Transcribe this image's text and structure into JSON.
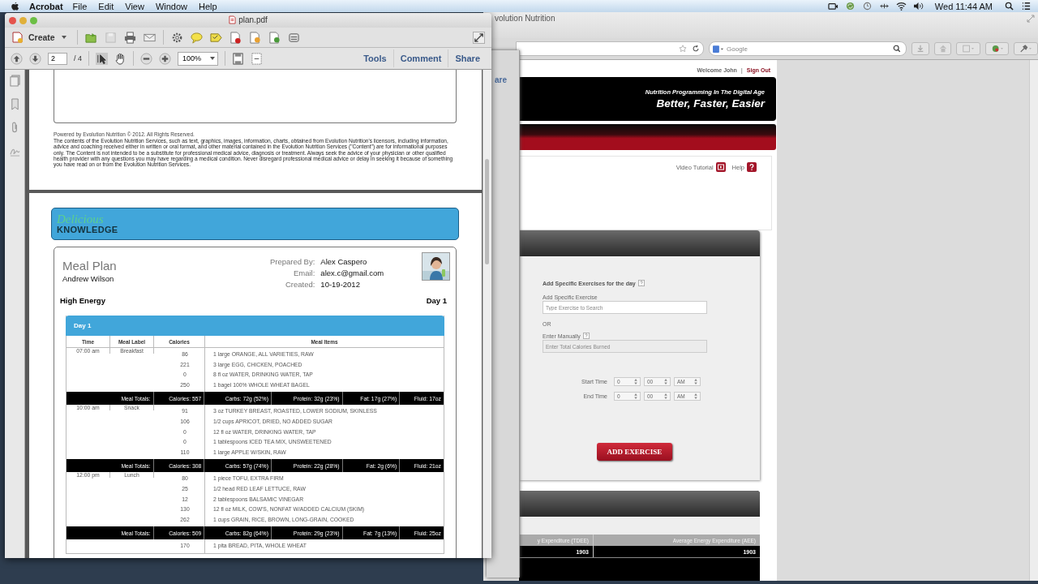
{
  "menubar": {
    "app": "Acrobat",
    "items": [
      "File",
      "Edit",
      "View",
      "Window",
      "Help"
    ],
    "clock": "Wed 11:44 AM"
  },
  "acrobat": {
    "title": "plan.pdf",
    "create": "Create",
    "page": "2",
    "page_count": "/ 4",
    "zoom": "100%",
    "panes": [
      "Tools",
      "Comment",
      "Share"
    ]
  },
  "pdf": {
    "powered": "Powered by Evolution Nutrition © 2012. All Rights Reserved.",
    "disclaimer": "The contents of the Evolution Nutrition Services, such as text, graphics, images, information, charts, obtained from Evolution Nutrition's licensors, including information, advice and coaching received either in written or oral format, and other material contained in the Evolution Nutrition Services (\"Content\") are for informational purposes only. The Content is not intended to be a substitute for professional medical advice, diagnosis or treatment. Always seek the advice of your physician or other qualified health provider with any questions you may have regarding a medical condition. Never disregard professional medical advice or delay in seeking it because of something you have read on or from the Evolution Nutrition Services.",
    "logo_script": "Delicious",
    "logo_word": "KNOWLEDGE",
    "heading": "Meal Plan",
    "client": "Andrew Wilson",
    "details": [
      {
        "label": "Prepared By:",
        "value": "Alex Caspero"
      },
      {
        "label": "Email:",
        "value": "alex.c@gmail.com"
      },
      {
        "label": "Created:",
        "value": "10-19-2012"
      }
    ],
    "plan_name": "High Energy",
    "day_label": "Day 1",
    "table": {
      "title": "Day 1",
      "columns": [
        "Time",
        "Meal Label",
        "Calories",
        "Meal Items"
      ],
      "meals": [
        {
          "time": "07:00 am",
          "label": "Breakfast",
          "items": [
            {
              "calories": "86",
              "item": "1 large ORANGE, ALL VARIETIES, RAW"
            },
            {
              "calories": "221",
              "item": "3 large EGG, CHICKEN, POACHED"
            },
            {
              "calories": "0",
              "item": "8 fl oz WATER, DRINKING WATER, TAP"
            },
            {
              "calories": "250",
              "item": "1 bagel 100% WHOLE WHEAT BAGEL"
            }
          ],
          "totals": {
            "label": "Meal Totals:",
            "values": [
              "Calories: 557",
              "Carbs: 72g (52%)",
              "Protein: 32g (23%)",
              "Fat: 17g (27%)",
              "Fluid: 17oz"
            ]
          }
        },
        {
          "time": "10:00 am",
          "label": "Snack",
          "items": [
            {
              "calories": "91",
              "item": "3 oz TURKEY BREAST, ROASTED, LOWER SODIUM, SKINLESS"
            },
            {
              "calories": "106",
              "item": "1/2 cups APRICOT, DRIED, NO ADDED SUGAR"
            },
            {
              "calories": "0",
              "item": "12 fl oz WATER, DRINKING WATER, TAP"
            },
            {
              "calories": "0",
              "item": "1 tablespoons ICED TEA MIX, UNSWEETENED"
            },
            {
              "calories": "110",
              "item": "1 large APPLE W/SKIN, RAW"
            }
          ],
          "totals": {
            "label": "Meal Totals:",
            "values": [
              "Calories: 308",
              "Carbs: 57g (74%)",
              "Protein: 22g (28%)",
              "Fat: 2g (6%)",
              "Fluid: 21oz"
            ]
          }
        },
        {
          "time": "12:00 pm",
          "label": "Lunch",
          "items": [
            {
              "calories": "80",
              "item": "1 piece TOFU, EXTRA FIRM"
            },
            {
              "calories": "25",
              "item": "1/2 head RED LEAF LETTUCE, RAW"
            },
            {
              "calories": "12",
              "item": "2 tablespoons BALSAMIC VINEGAR"
            },
            {
              "calories": "130",
              "item": "12 fl oz MILK, COW'S, NONFAT W/ADDED CALCIUM (SKIM)"
            },
            {
              "calories": "262",
              "item": "1 cups GRAIN, RICE, BROWN, LONG-GRAIN, COOKED"
            }
          ],
          "totals": {
            "label": "Meal Totals:",
            "values": [
              "Calories: 509",
              "Carbs: 82g (64%)",
              "Protein: 29g (23%)",
              "Fat: 7g (13%)",
              "Fluid: 25oz"
            ]
          }
        },
        {
          "items": [
            {
              "calories": "170",
              "item": "1 pita BREAD, PITA, WHOLE WHEAT"
            }
          ]
        }
      ]
    }
  },
  "back_window": {
    "fragment": "are"
  },
  "browser": {
    "title": "volution Nutrition",
    "search_placeholder": "Google",
    "welcome": "Welcome John",
    "welcome_separator": "|",
    "sign_out": "Sign Out",
    "tagline": "Nutrition Programming In The Digital Age",
    "slogan": "Better, Faster, Easier",
    "links": [
      {
        "label": "Video Tutorial",
        "kind": "video"
      },
      {
        "label": "Help",
        "kind": "help"
      }
    ],
    "exercise_form": {
      "heading": "Add Specific Exercises for the day",
      "search_label": "Add Specific Exercise",
      "search_placeholder": "Type Exercise to Search",
      "or_text": "OR",
      "manual_label": "Enter Manually",
      "manual_placeholder": "Enter Total Calories Burned",
      "manual_disabled": true,
      "times": [
        {
          "label": "Start Time",
          "hour": "0",
          "minute": "00",
          "period": "AM"
        },
        {
          "label": "End Time",
          "hour": "0",
          "minute": "00",
          "period": "AM"
        }
      ],
      "button": "ADD EXERCISE"
    },
    "energy_table": {
      "columns": [
        "y Expenditure (TDEE)",
        "Average Energy Expenditure (AEE)"
      ],
      "values": [
        "1903",
        "1903"
      ]
    }
  }
}
